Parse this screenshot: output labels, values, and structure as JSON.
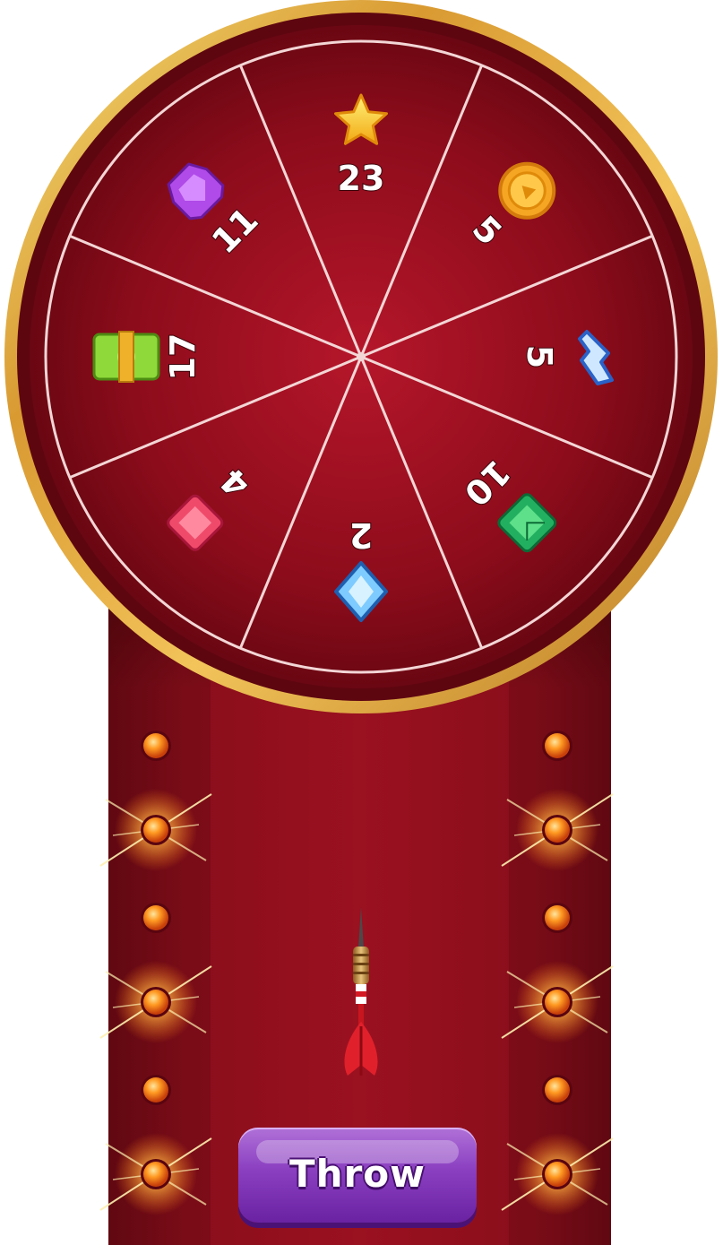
{
  "wheel": {
    "segments": [
      {
        "label": "23",
        "icon": "star-icon"
      },
      {
        "label": "5",
        "icon": "coin-icon"
      },
      {
        "label": "5",
        "icon": "lightning-icon"
      },
      {
        "label": "10",
        "icon": "green-gem-icon"
      },
      {
        "label": "2",
        "icon": "blue-diamond-icon"
      },
      {
        "label": "4",
        "icon": "red-gem-icon"
      },
      {
        "label": "17",
        "icon": "cash-icon"
      },
      {
        "label": "11",
        "icon": "purple-gem-icon"
      }
    ]
  },
  "throw_button": {
    "label": "Throw"
  },
  "colors": {
    "wheel_red": "#9a0f1e",
    "rim_gold": "#e0a43a",
    "button_purple": "#8a3fc0"
  }
}
